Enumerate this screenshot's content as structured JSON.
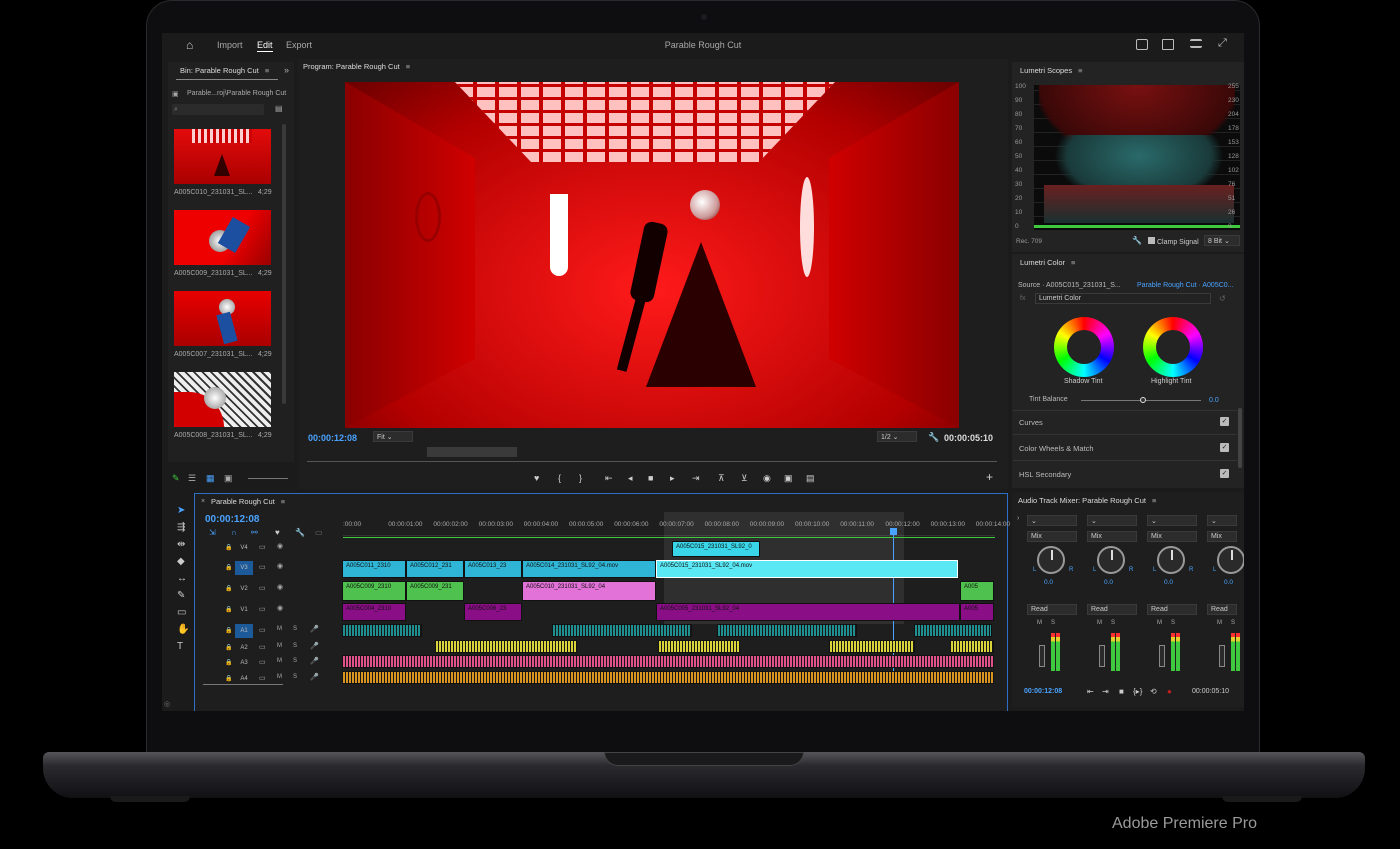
{
  "caption": "Adobe Premiere Pro",
  "topbar": {
    "import": "Import",
    "edit": "Edit",
    "export": "Export",
    "title": "Parable Rough Cut"
  },
  "bin": {
    "title": "Bin: Parable Rough Cut",
    "path": "Parable...roj\\Parable Rough Cut",
    "items": [
      {
        "name": "A005C010_231031_SL...",
        "duration": "4;29"
      },
      {
        "name": "A005C009_231031_SL...",
        "duration": "4;29"
      },
      {
        "name": "A005C007_231031_SL...",
        "duration": "4;29"
      },
      {
        "name": "A005C008_231031_SL...",
        "duration": "4;29"
      }
    ]
  },
  "program": {
    "title": "Program: Parable Rough Cut",
    "timecode": "00:00:12:08",
    "fit": "Fit",
    "resolution": "1/2",
    "duration": "00:00:05:10"
  },
  "timeline": {
    "title": "Parable Rough Cut",
    "timecode": "00:00:12:08",
    "ruler": [
      ":00:00",
      "00:00:01:00",
      "00:00:02:00",
      "00:00:03:00",
      "00:00:04:00",
      "00:00:05:00",
      "00:00:06:00",
      "00:00:07:00",
      "00:00:08:00",
      "00:00:09:00",
      "00:00:10:00",
      "00:00:11:00",
      "00:00:12:00",
      "00:00:13:00",
      "00:00:14:00"
    ],
    "tracks": [
      "V4",
      "V3",
      "V2",
      "V1",
      "A1",
      "A2",
      "A3",
      "A4"
    ],
    "clips": {
      "v4a": "A005C015_231031_SL92_0",
      "v3a": "A005C011_2310",
      "v3b": "A005C012_231",
      "v3c": "A005C013_23",
      "v3d": "A005C014_231031_SL92_04.mov",
      "v3e": "A005C015_231031_SL92_04.mov",
      "v2a": "A005C009_2310",
      "v2b": "A005C009_231",
      "v2c": "A005C010_231031_SL92_04",
      "v2d": "A005",
      "v1a": "A005C004_2310",
      "v1b": "A005C006_23",
      "v1c": "A005C005_231031_SL92_04",
      "v1d": "A005"
    },
    "mute": "M",
    "solo": "S"
  },
  "scopes": {
    "title": "Lumetri Scopes",
    "left_scale": [
      "100",
      "90",
      "80",
      "70",
      "60",
      "50",
      "40",
      "30",
      "20",
      "10",
      "0"
    ],
    "right_scale": [
      "255",
      "230",
      "204",
      "178",
      "153",
      "128",
      "102",
      "76",
      "51",
      "26",
      "0"
    ],
    "rec": "Rec. 709",
    "clamp": "Clamp Signal",
    "bit": "8 Bit"
  },
  "lumetri": {
    "title": "Lumetri Color",
    "source": "Source · A005C015_231031_S...",
    "sequence": "Parable Rough Cut · A005C0...",
    "effect": "Lumetri Color",
    "shadow": "Shadow Tint",
    "highlight": "Highlight Tint",
    "tint_balance": "Tint Balance",
    "tint_value": "0.0",
    "curves": "Curves",
    "wheels": "Color Wheels & Match",
    "hsl": "HSL Secondary"
  },
  "mixer": {
    "title": "Audio Track Mixer: Parable Rough Cut",
    "mix": "Mix",
    "read": "Read",
    "value": "0.0",
    "l": "L",
    "r": "R",
    "m": "M",
    "s": "S",
    "timecode": "00:00:12:08",
    "duration": "00:00:05:10"
  }
}
